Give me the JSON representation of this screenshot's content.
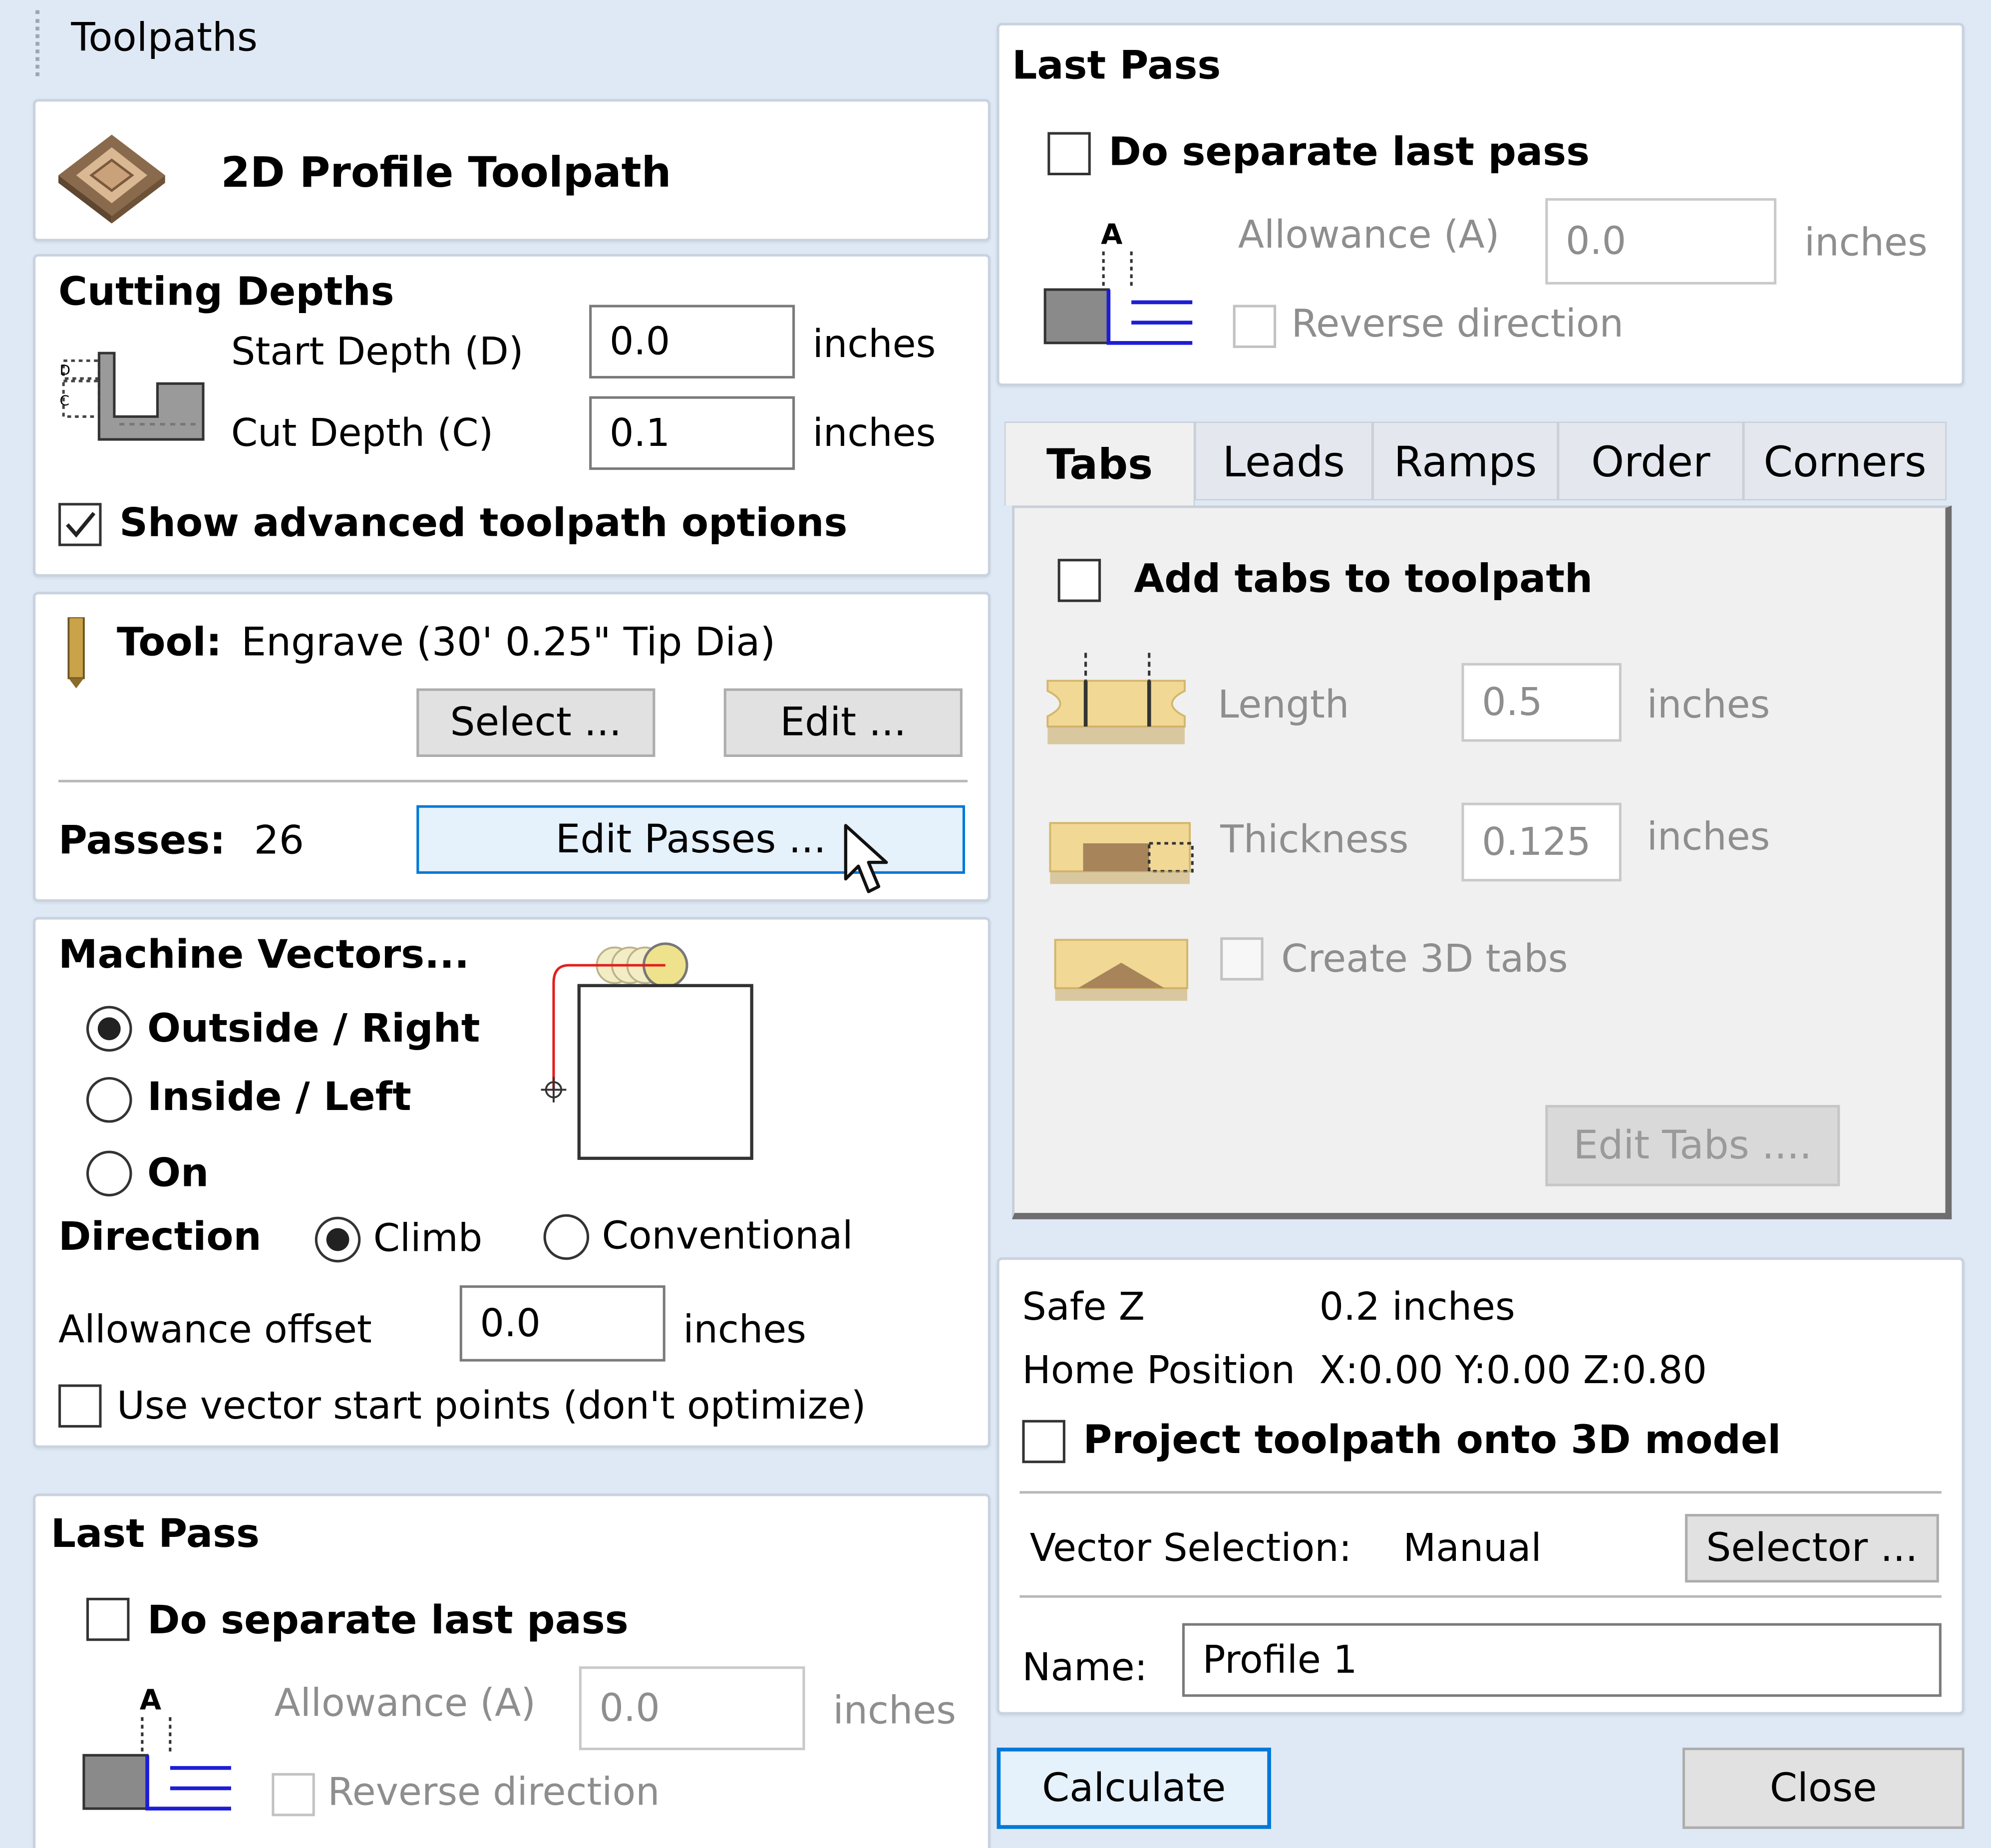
{
  "window": {
    "title": "Toolpaths"
  },
  "header": {
    "title": "2D Profile Toolpath",
    "icon": "profile-toolpath-icon"
  },
  "cutting_depths": {
    "heading": "Cutting Depths",
    "start_label": "Start Depth (D)",
    "start_value": "0.0",
    "cut_label": "Cut Depth (C)",
    "cut_value": "0.1",
    "unit": "inches",
    "diagram_d": "D",
    "diagram_c": "C",
    "advanced_label": "Show advanced toolpath options",
    "advanced_checked": true
  },
  "tool": {
    "label": "Tool:",
    "name": "Engrave (30' 0.25\" Tip Dia)",
    "select_label": "Select ...",
    "edit_label": "Edit ...",
    "passes_label": "Passes:",
    "passes_value": "26",
    "edit_passes_label": "Edit Passes ..."
  },
  "machine_vectors": {
    "heading": "Machine Vectors...",
    "options": [
      "Outside / Right",
      "Inside / Left",
      "On"
    ],
    "selected": "Outside / Right",
    "direction_label": "Direction",
    "direction_options": [
      "Climb",
      "Conventional"
    ],
    "direction_selected": "Climb",
    "allowance_label": "Allowance offset",
    "allowance_value": "0.0",
    "unit": "inches",
    "start_points_label": "Use vector start points (don't optimize)"
  },
  "last_pass_left": {
    "heading": "Last Pass",
    "separate_label": "Do separate last pass",
    "allowance_label": "Allowance (A)",
    "allowance_value": "0.0",
    "unit": "inches",
    "reverse_label": "Reverse direction",
    "diagram_a": "A"
  },
  "last_pass_right": {
    "heading": "Last Pass",
    "separate_label": "Do separate last pass",
    "allowance_label": "Allowance (A)",
    "allowance_value": "0.0",
    "unit": "inches",
    "reverse_label": "Reverse direction",
    "diagram_a": "A"
  },
  "tabs_bar": {
    "tabs": [
      "Tabs",
      "Leads",
      "Ramps",
      "Order",
      "Corners"
    ],
    "active": "Tabs"
  },
  "tabs_panel": {
    "add_tabs_label": "Add tabs to toolpath",
    "length_label": "Length",
    "length_value": "0.5",
    "thickness_label": "Thickness",
    "thickness_value": "0.125",
    "unit": "inches",
    "create_3d_label": "Create 3D tabs",
    "edit_tabs_label": "Edit Tabs ...."
  },
  "footer": {
    "safe_z_label": "Safe Z",
    "safe_z_value": "0.2 inches",
    "home_label": "Home Position",
    "home_value": "X:0.00 Y:0.00 Z:0.80",
    "project_label": "Project toolpath onto 3D model",
    "vector_selection_label": "Vector Selection:",
    "vector_selection_value": "Manual",
    "selector_label": "Selector ...",
    "name_label": "Name:",
    "name_value": "Profile 1",
    "calculate_label": "Calculate",
    "close_label": "Close"
  },
  "colors": {
    "background": "#dfe9f5",
    "accent": "#0078d7",
    "tool_path": "#e02020",
    "last_pass_lines": "#1d1dd6"
  }
}
